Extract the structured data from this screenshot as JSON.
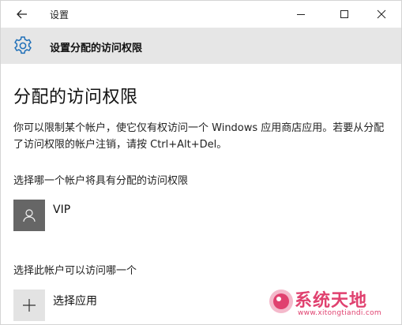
{
  "titlebar": {
    "app_title": "设置",
    "icons": {
      "back": "back-arrow-icon",
      "minimize": "minimize-icon",
      "maximize": "maximize-icon",
      "close": "close-icon"
    }
  },
  "header": {
    "icon": "gear-icon",
    "title": "设置分配的访问权限"
  },
  "main": {
    "page_title": "分配的访问权限",
    "description": "你可以限制某个帐户，使它仅有权访问一个 Windows 应用商店应用。若要从分配了访问权限的帐户注销，请按 Ctrl+Alt+Del。",
    "account_section_label": "选择哪一个帐户将具有分配的访问权限",
    "account": {
      "name": "VIP",
      "icon": "user-avatar-icon"
    },
    "app_section_label": "选择此帐户可以访问哪一个",
    "choose_app": {
      "label": "选择应用",
      "icon": "plus-icon"
    }
  },
  "watermark": {
    "text": "系统天地",
    "url": "www.xitongtiandi.com",
    "color": "#e0416f"
  }
}
